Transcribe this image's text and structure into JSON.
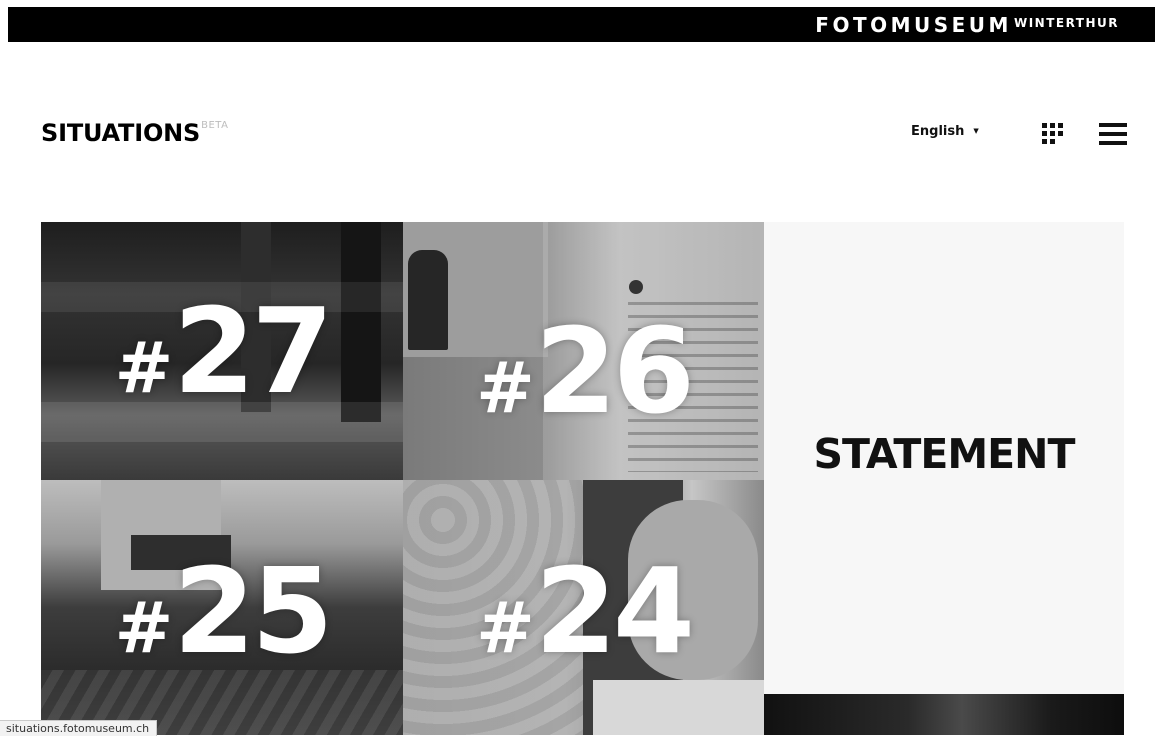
{
  "header": {
    "brand_main": "FOTOMUSEUM",
    "brand_sub": "WINTERTHUR"
  },
  "site": {
    "title": "SITUATIONS",
    "badge": "BETA"
  },
  "nav": {
    "language": "English",
    "grid_icon": "grid-icon",
    "menu_icon": "hamburger-menu-icon"
  },
  "tiles": [
    {
      "hash": "#",
      "number": "27"
    },
    {
      "hash": "#",
      "number": "26"
    },
    {
      "hash": "#",
      "number": "25"
    },
    {
      "hash": "#",
      "number": "24"
    }
  ],
  "statement": {
    "label": "STATEMENT"
  },
  "status_bar": {
    "url": "situations.fotomuseum.ch"
  },
  "colors": {
    "topbar": "#000000",
    "background": "#ffffff",
    "statement_bg": "#f7f7f7"
  }
}
